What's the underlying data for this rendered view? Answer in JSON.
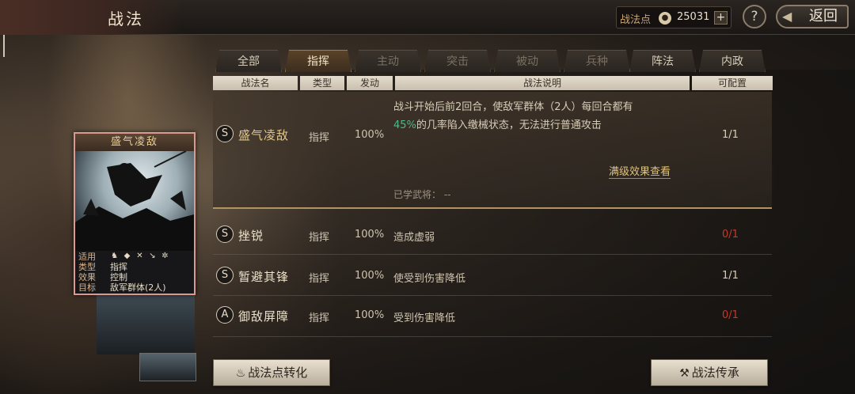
{
  "header": {
    "title": "战法",
    "points_label": "战法点",
    "points_icon": "flame-coin-icon",
    "points_value": "25031",
    "add_label": "+",
    "help_label": "?",
    "back_label": "返回"
  },
  "tabs": [
    {
      "label": "全部",
      "state": "enabled"
    },
    {
      "label": "指挥",
      "state": "active"
    },
    {
      "label": "主动",
      "state": "disabled"
    },
    {
      "label": "突击",
      "state": "disabled"
    },
    {
      "label": "被动",
      "state": "disabled"
    },
    {
      "label": "兵种",
      "state": "disabled"
    },
    {
      "label": "阵法",
      "state": "enabled"
    },
    {
      "label": "内政",
      "state": "enabled"
    }
  ],
  "columns": {
    "name": "战法名",
    "type": "类型",
    "rate": "发动",
    "desc": "战法说明",
    "config": "可配置"
  },
  "skills": [
    {
      "grade": "S",
      "name": "盛气凌敌",
      "type": "指挥",
      "rate": "100%",
      "desc_line1": "战斗开始后前2回合，使敌军群体（2人）每回合都有",
      "desc_pct": "45%",
      "desc_line2": "的几率陷入缴械状态，无法进行普通攻击",
      "config": "1/1",
      "full_effect_label": "满级效果查看",
      "learned_label": "已学武将：  --"
    },
    {
      "grade": "S",
      "name": "挫锐",
      "type": "指挥",
      "rate": "100%",
      "desc": "造成虚弱",
      "config": "0/1",
      "config_color": "#c43a2e"
    },
    {
      "grade": "S",
      "name": "暂避其锋",
      "type": "指挥",
      "rate": "100%",
      "desc": "使受到伤害降低",
      "config": "1/1"
    },
    {
      "grade": "A",
      "name": "御敌屏障",
      "type": "指挥",
      "rate": "100%",
      "desc": "受到伤害降低",
      "config": "0/1",
      "config_color": "#c43a2e"
    }
  ],
  "card": {
    "name": "盛气凌敌",
    "suit_label": "适用",
    "suit_icons": [
      "cavalry-icon",
      "shield-icon",
      "bow-icon",
      "spear-icon",
      "wheel-icon"
    ],
    "type_label": "类型",
    "type_value": "指挥",
    "effect_label": "效果",
    "effect_value": "控制",
    "target_label": "目标",
    "target_value": "敌军群体(2人)"
  },
  "buttons": {
    "convert": "战法点转化",
    "convert_icon": "flame-icon",
    "inherit": "战法传承",
    "inherit_icon": "hammer-icon"
  }
}
